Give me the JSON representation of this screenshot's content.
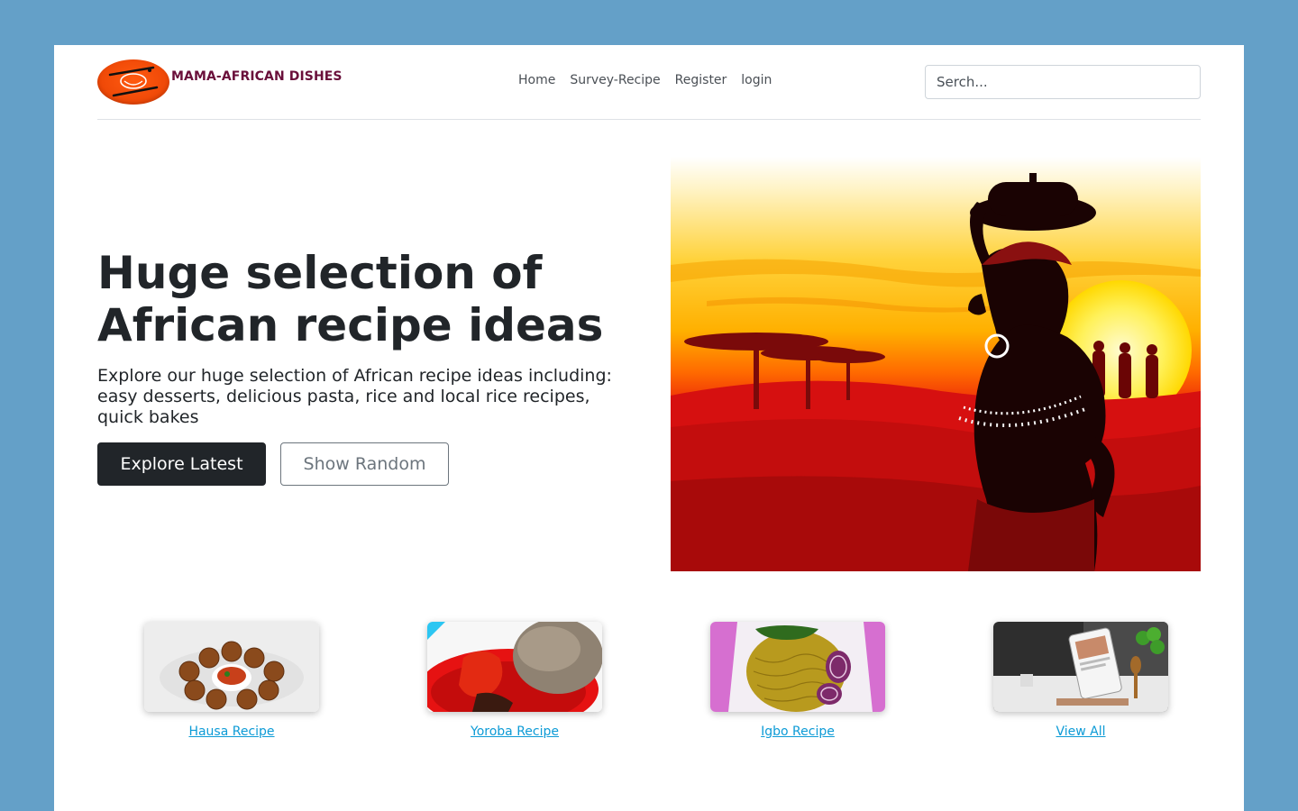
{
  "header": {
    "brand_name": "MAMA-AFRICAN DISHES",
    "nav": [
      "Home",
      "Survey-Recipe",
      "Register",
      "login"
    ],
    "search_placeholder": "Serch..."
  },
  "hero": {
    "title": "Huge selection of African recipe ideas",
    "description": "Explore our huge selection of African recipe ideas including: easy desserts, delicious pasta, rice and local rice recipes, quick bakes",
    "primary_button": "Explore Latest",
    "secondary_button": "Show Random"
  },
  "categories": [
    {
      "label": "Hausa Recipe"
    },
    {
      "label": "Yoroba Recipe"
    },
    {
      "label": "Igbo Recipe"
    },
    {
      "label": "View All"
    }
  ],
  "colors": {
    "background": "#64a0c8",
    "brand": "#6a0f3a",
    "primary_button": "#212529",
    "link": "#0d9bd6"
  }
}
